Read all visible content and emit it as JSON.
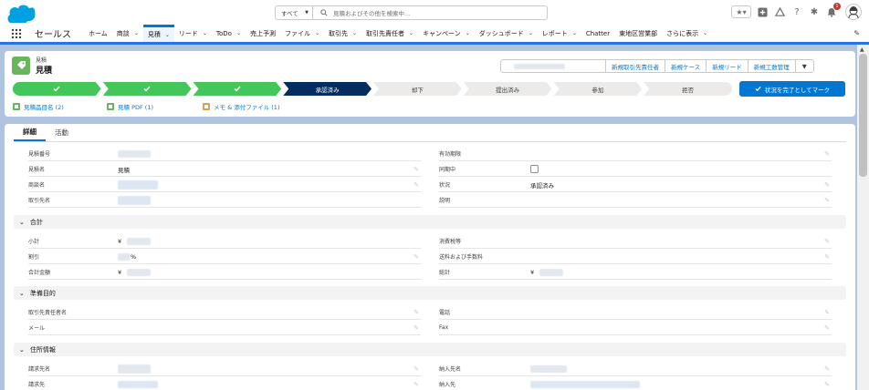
{
  "header": {
    "search_scope": "すべて",
    "search_placeholder": "見積およびその他を検索中...",
    "notification_count": "1"
  },
  "nav": {
    "app_name": "セールス",
    "items": [
      {
        "label": "ホーム",
        "chevron": false
      },
      {
        "label": "商談",
        "chevron": true
      },
      {
        "label": "見積",
        "chevron": true,
        "active": true
      },
      {
        "label": "リード",
        "chevron": true
      },
      {
        "label": "ToDo",
        "chevron": true
      },
      {
        "label": "売上予測",
        "chevron": false
      },
      {
        "label": "ファイル",
        "chevron": true
      },
      {
        "label": "取引先",
        "chevron": true
      },
      {
        "label": "取引先責任者",
        "chevron": true
      },
      {
        "label": "キャンペーン",
        "chevron": true
      },
      {
        "label": "ダッシュボード",
        "chevron": true
      },
      {
        "label": "レポート",
        "chevron": true
      },
      {
        "label": "Chatter",
        "chevron": false
      },
      {
        "label": "東地区営業部",
        "chevron": false
      },
      {
        "label": "さらに表示",
        "chevron": true
      }
    ]
  },
  "record": {
    "object_type": "見積",
    "title": "見積",
    "actions": [
      "新規取引先責任者",
      "新規ケース",
      "新規リード",
      "新規工数管理"
    ]
  },
  "path": {
    "steps": [
      {
        "label": "",
        "state": "done"
      },
      {
        "label": "",
        "state": "done"
      },
      {
        "label": "",
        "state": "done"
      },
      {
        "label": "承認済み",
        "state": "current"
      },
      {
        "label": "却下",
        "state": "todo"
      },
      {
        "label": "提出済み",
        "state": "todo"
      },
      {
        "label": "参加",
        "state": "todo"
      },
      {
        "label": "拒否",
        "state": "todo"
      }
    ],
    "complete_button": "状況を完了としてマーク"
  },
  "related": [
    {
      "label": "見積品目名 (2)",
      "color": "#6ab55e"
    },
    {
      "label": "見積 PDF (1)",
      "color": "#6ab55e"
    },
    {
      "label": "メモ & 添付ファイル (1)",
      "color": "#d8a05a"
    }
  ],
  "tabs": [
    "詳細",
    "活動"
  ],
  "fields": {
    "quote_number_label": "見積番号",
    "expiration_label": "有効期限",
    "quote_name_label": "見積名",
    "quote_name_value": "見積",
    "syncing_label": "同期中",
    "opportunity_label": "商談名",
    "status_label": "状況",
    "status_value": "承認済み",
    "account_label": "取引先名",
    "description_label": "説明"
  },
  "sections": {
    "totals": "合計",
    "prepared_for": "準備目的",
    "address": "住所情報"
  },
  "totals": {
    "subtotal_label": "小計",
    "subtotal_currency": "¥",
    "tax_label": "消費税等",
    "discount_label": "割引",
    "discount_suffix": "%",
    "shipping_label": "送料および手数料",
    "total_label": "合計金額",
    "total_currency": "¥",
    "grand_total_label": "総計",
    "grand_total_currency": "¥"
  },
  "prepared": {
    "contact_label": "取引先責任者名",
    "phone_label": "電話",
    "email_label": "メール",
    "fax_label": "Fax"
  },
  "address": {
    "bill_name_label": "請求先名",
    "ship_name_label": "納入先名",
    "bill_to_label": "請求先",
    "ship_to_label": "納入先"
  }
}
